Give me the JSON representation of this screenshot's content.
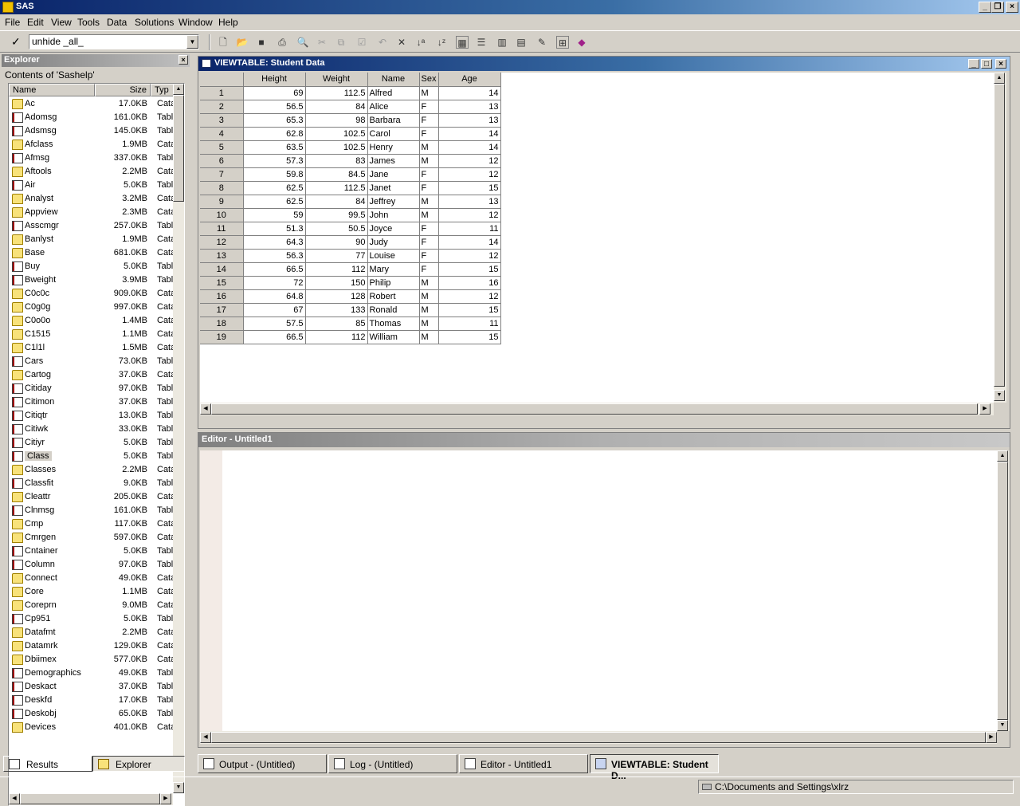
{
  "app": {
    "title": "SAS"
  },
  "menu": [
    "File",
    "Edit",
    "View",
    "Tools",
    "Data",
    "Solutions",
    "Window",
    "Help"
  ],
  "command_box": {
    "value": "unhide _all_"
  },
  "explorer": {
    "title": "Explorer",
    "contents_label": "Contents of 'Sashelp'",
    "columns": [
      "Name",
      "Size",
      "Typ"
    ],
    "items": [
      {
        "name": "Ac",
        "size": "17.0KB",
        "type": "Cata",
        "kind": "folder"
      },
      {
        "name": "Adomsg",
        "size": "161.0KB",
        "type": "Tabl",
        "kind": "table"
      },
      {
        "name": "Adsmsg",
        "size": "145.0KB",
        "type": "Tabl",
        "kind": "table"
      },
      {
        "name": "Afclass",
        "size": "1.9MB",
        "type": "Cata",
        "kind": "folder"
      },
      {
        "name": "Afmsg",
        "size": "337.0KB",
        "type": "Tabl",
        "kind": "table"
      },
      {
        "name": "Aftools",
        "size": "2.2MB",
        "type": "Cata",
        "kind": "folder"
      },
      {
        "name": "Air",
        "size": "5.0KB",
        "type": "Tabl",
        "kind": "table"
      },
      {
        "name": "Analyst",
        "size": "3.2MB",
        "type": "Cata",
        "kind": "folder"
      },
      {
        "name": "Appview",
        "size": "2.3MB",
        "type": "Cata",
        "kind": "folder"
      },
      {
        "name": "Asscmgr",
        "size": "257.0KB",
        "type": "Tabl",
        "kind": "table"
      },
      {
        "name": "Banlyst",
        "size": "1.9MB",
        "type": "Cata",
        "kind": "folder"
      },
      {
        "name": "Base",
        "size": "681.0KB",
        "type": "Cata",
        "kind": "folder"
      },
      {
        "name": "Buy",
        "size": "5.0KB",
        "type": "Tabl",
        "kind": "table"
      },
      {
        "name": "Bweight",
        "size": "3.9MB",
        "type": "Tabl",
        "kind": "table"
      },
      {
        "name": "C0c0c",
        "size": "909.0KB",
        "type": "Cata",
        "kind": "folder"
      },
      {
        "name": "C0g0g",
        "size": "997.0KB",
        "type": "Cata",
        "kind": "folder"
      },
      {
        "name": "C0o0o",
        "size": "1.4MB",
        "type": "Cata",
        "kind": "folder"
      },
      {
        "name": "C1515",
        "size": "1.1MB",
        "type": "Cata",
        "kind": "folder"
      },
      {
        "name": "C1l1l",
        "size": "1.5MB",
        "type": "Cata",
        "kind": "folder"
      },
      {
        "name": "Cars",
        "size": "73.0KB",
        "type": "Tabl",
        "kind": "table"
      },
      {
        "name": "Cartog",
        "size": "37.0KB",
        "type": "Cata",
        "kind": "folder"
      },
      {
        "name": "Citiday",
        "size": "97.0KB",
        "type": "Tabl",
        "kind": "table"
      },
      {
        "name": "Citimon",
        "size": "37.0KB",
        "type": "Tabl",
        "kind": "table"
      },
      {
        "name": "Citiqtr",
        "size": "13.0KB",
        "type": "Tabl",
        "kind": "table"
      },
      {
        "name": "Citiwk",
        "size": "33.0KB",
        "type": "Tabl",
        "kind": "table"
      },
      {
        "name": "Citiyr",
        "size": "5.0KB",
        "type": "Tabl",
        "kind": "table"
      },
      {
        "name": "Class",
        "size": "5.0KB",
        "type": "Tabl",
        "kind": "table",
        "selected": true
      },
      {
        "name": "Classes",
        "size": "2.2MB",
        "type": "Cata",
        "kind": "folder"
      },
      {
        "name": "Classfit",
        "size": "9.0KB",
        "type": "Tabl",
        "kind": "table"
      },
      {
        "name": "Cleattr",
        "size": "205.0KB",
        "type": "Cata",
        "kind": "folder"
      },
      {
        "name": "Clnmsg",
        "size": "161.0KB",
        "type": "Tabl",
        "kind": "table"
      },
      {
        "name": "Cmp",
        "size": "117.0KB",
        "type": "Cata",
        "kind": "folder"
      },
      {
        "name": "Cmrgen",
        "size": "597.0KB",
        "type": "Cata",
        "kind": "folder"
      },
      {
        "name": "Cntainer",
        "size": "5.0KB",
        "type": "Tabl",
        "kind": "table"
      },
      {
        "name": "Column",
        "size": "97.0KB",
        "type": "Tabl",
        "kind": "table"
      },
      {
        "name": "Connect",
        "size": "49.0KB",
        "type": "Cata",
        "kind": "folder"
      },
      {
        "name": "Core",
        "size": "1.1MB",
        "type": "Cata",
        "kind": "folder"
      },
      {
        "name": "Coreprn",
        "size": "9.0MB",
        "type": "Cata",
        "kind": "folder"
      },
      {
        "name": "Cp951",
        "size": "5.0KB",
        "type": "Tabl",
        "kind": "table"
      },
      {
        "name": "Datafmt",
        "size": "2.2MB",
        "type": "Cata",
        "kind": "folder"
      },
      {
        "name": "Datamrk",
        "size": "129.0KB",
        "type": "Cata",
        "kind": "folder"
      },
      {
        "name": "Dbiimex",
        "size": "577.0KB",
        "type": "Cata",
        "kind": "folder"
      },
      {
        "name": "Demographics",
        "size": "49.0KB",
        "type": "Tabl",
        "kind": "table"
      },
      {
        "name": "Deskact",
        "size": "37.0KB",
        "type": "Tabl",
        "kind": "table"
      },
      {
        "name": "Deskfd",
        "size": "17.0KB",
        "type": "Tabl",
        "kind": "table"
      },
      {
        "name": "Deskobj",
        "size": "65.0KB",
        "type": "Tabl",
        "kind": "table"
      },
      {
        "name": "Devices",
        "size": "401.0KB",
        "type": "Cata",
        "kind": "folder"
      }
    ],
    "tabs": [
      "Results",
      "Explorer"
    ]
  },
  "viewtable": {
    "title": "VIEWTABLE: Student Data",
    "columns": [
      "Height",
      "Weight",
      "Name",
      "Sex",
      "Age"
    ],
    "rows": [
      [
        "1",
        "69",
        "112.5",
        "Alfred",
        "M",
        "14"
      ],
      [
        "2",
        "56.5",
        "84",
        "Alice",
        "F",
        "13"
      ],
      [
        "3",
        "65.3",
        "98",
        "Barbara",
        "F",
        "13"
      ],
      [
        "4",
        "62.8",
        "102.5",
        "Carol",
        "F",
        "14"
      ],
      [
        "5",
        "63.5",
        "102.5",
        "Henry",
        "M",
        "14"
      ],
      [
        "6",
        "57.3",
        "83",
        "James",
        "M",
        "12"
      ],
      [
        "7",
        "59.8",
        "84.5",
        "Jane",
        "F",
        "12"
      ],
      [
        "8",
        "62.5",
        "112.5",
        "Janet",
        "F",
        "15"
      ],
      [
        "9",
        "62.5",
        "84",
        "Jeffrey",
        "M",
        "13"
      ],
      [
        "10",
        "59",
        "99.5",
        "John",
        "M",
        "12"
      ],
      [
        "11",
        "51.3",
        "50.5",
        "Joyce",
        "F",
        "11"
      ],
      [
        "12",
        "64.3",
        "90",
        "Judy",
        "F",
        "14"
      ],
      [
        "13",
        "56.3",
        "77",
        "Louise",
        "F",
        "12"
      ],
      [
        "14",
        "66.5",
        "112",
        "Mary",
        "F",
        "15"
      ],
      [
        "15",
        "72",
        "150",
        "Philip",
        "M",
        "16"
      ],
      [
        "16",
        "64.8",
        "128",
        "Robert",
        "M",
        "12"
      ],
      [
        "17",
        "67",
        "133",
        "Ronald",
        "M",
        "15"
      ],
      [
        "18",
        "57.5",
        "85",
        "Thomas",
        "M",
        "11"
      ],
      [
        "19",
        "66.5",
        "112",
        "William",
        "M",
        "15"
      ]
    ]
  },
  "editor": {
    "title": "Editor - Untitled1"
  },
  "window_tabs": [
    "Output - (Untitled)",
    "Log - (Untitled)",
    "Editor - Untitled1",
    "VIEWTABLE: Student D..."
  ],
  "status": {
    "path": "C:\\Documents and Settings\\xlrz"
  }
}
